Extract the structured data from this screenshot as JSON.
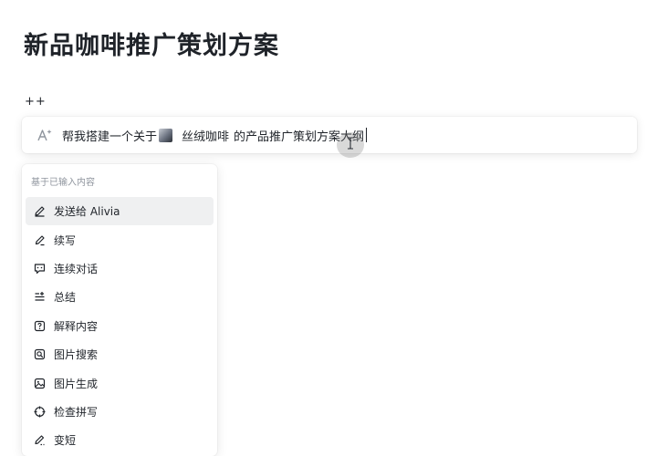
{
  "page": {
    "title": "新品咖啡推广策划方案",
    "trigger_text": "++"
  },
  "ai_bar": {
    "prompt_before": "帮我搭建一个关于",
    "mention_label": "丝绒咖啡",
    "prompt_after": "的产品推广策划方案大纲",
    "icon": "ai-sparkle-icon"
  },
  "menu": {
    "header": "基于已输入内容",
    "items": [
      {
        "label": "发送给 Alivia",
        "icon": "pencil-icon",
        "active": true
      },
      {
        "label": "续写",
        "icon": "pen-icon"
      },
      {
        "label": "连续对话",
        "icon": "chat-icon"
      },
      {
        "label": "总结",
        "icon": "summary-icon"
      },
      {
        "label": "解释内容",
        "icon": "question-icon"
      },
      {
        "label": "图片搜索",
        "icon": "image-search-icon"
      },
      {
        "label": "图片生成",
        "icon": "image-icon"
      },
      {
        "label": "检查拼写",
        "icon": "crosshair-icon"
      },
      {
        "label": "变短",
        "icon": "shorten-icon"
      }
    ]
  }
}
